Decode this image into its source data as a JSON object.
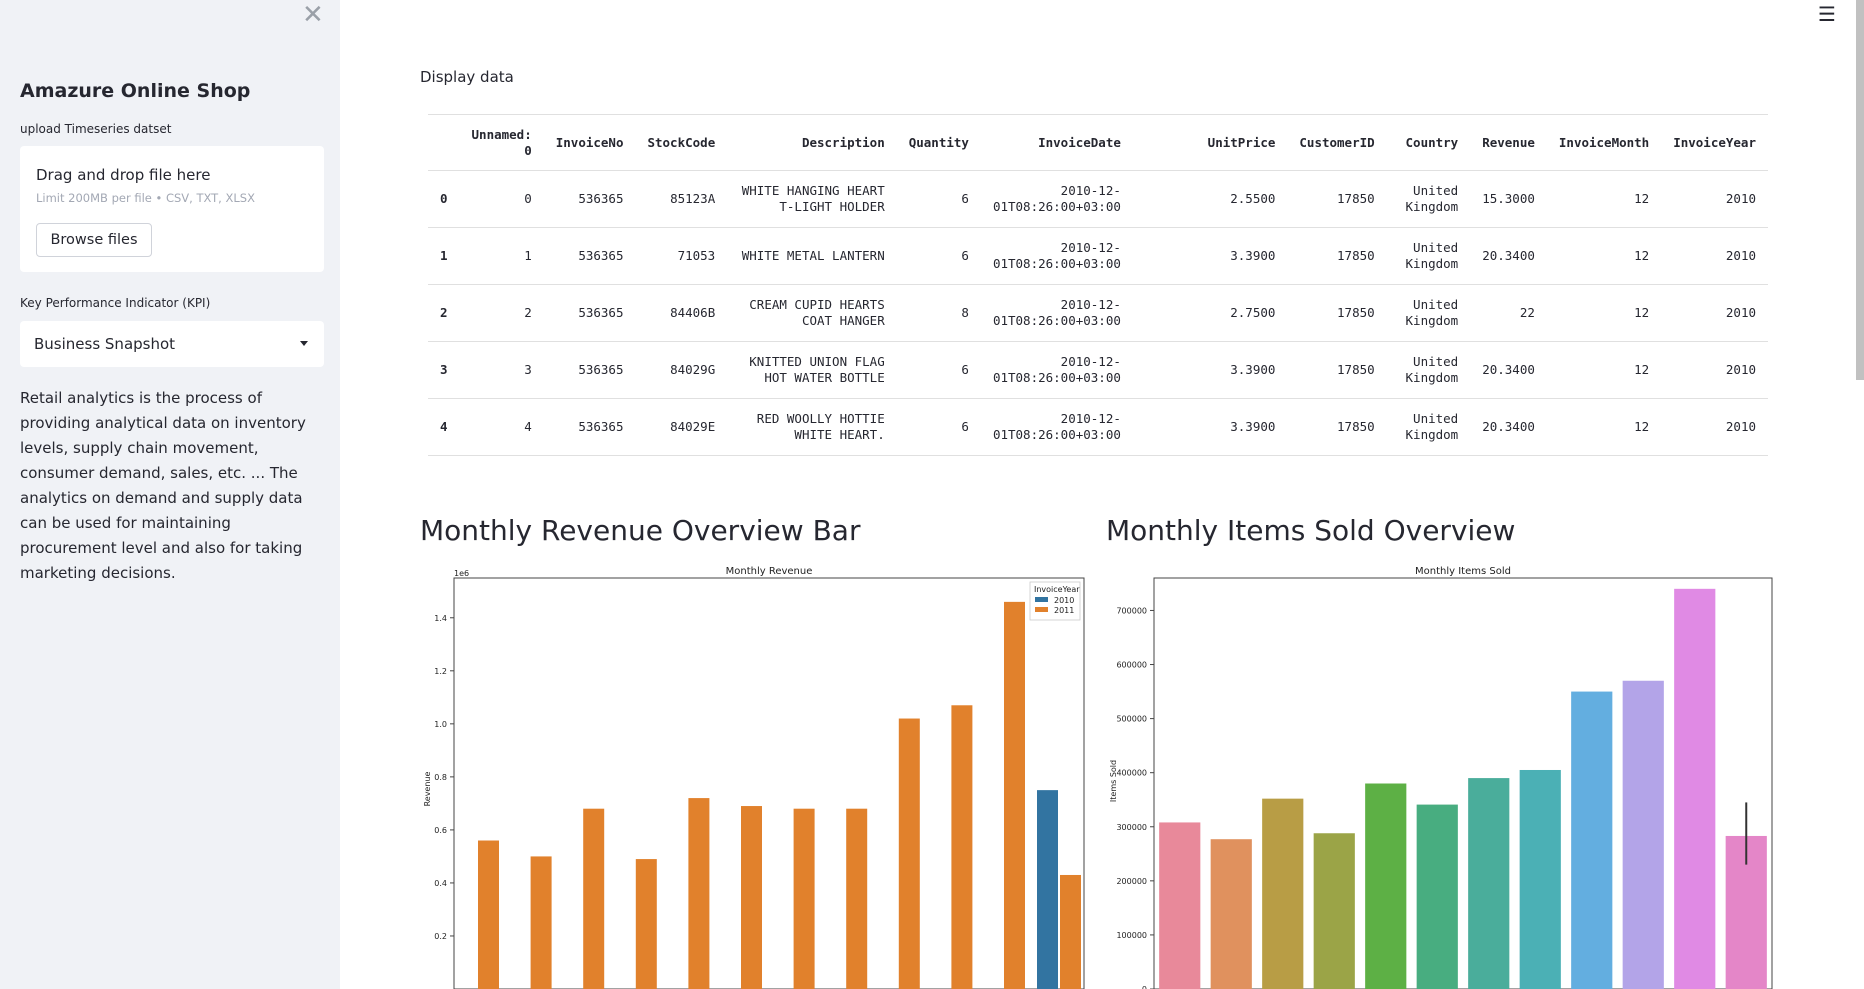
{
  "sidebar": {
    "title": "Amazure Online Shop",
    "upload_label": "upload Timeseries datset",
    "uploader_title": "Drag and drop file here",
    "uploader_limit": "Limit 200MB per file • CSV, TXT, XLSX",
    "browse_label": "Browse files",
    "kpi_label": "Key Performance Indicator (KPI)",
    "kpi_selected": "Business Snapshot",
    "description": "Retail analytics is the process of providing analytical data on inventory levels, supply chain movement, consumer demand, sales, etc. ... The analytics on demand and supply data can be used for maintaining procurement level and also for taking marketing decisions."
  },
  "main": {
    "display_label": "Display data",
    "table": {
      "headers": [
        "Unnamed: 0",
        "InvoiceNo",
        "StockCode",
        "Description",
        "Quantity",
        "InvoiceDate",
        "UnitPrice",
        "CustomerID",
        "Country",
        "Revenue",
        "InvoiceMonth",
        "InvoiceYear"
      ],
      "rows": [
        [
          "0",
          "0",
          "536365",
          "85123A",
          "WHITE HANGING HEART T-LIGHT HOLDER",
          "6",
          "2010-12-01T08:26:00+03:00",
          "2.5500",
          "17850",
          "United Kingdom",
          "15.3000",
          "12",
          "2010"
        ],
        [
          "1",
          "1",
          "536365",
          "71053",
          "WHITE METAL LANTERN",
          "6",
          "2010-12-01T08:26:00+03:00",
          "3.3900",
          "17850",
          "United Kingdom",
          "20.3400",
          "12",
          "2010"
        ],
        [
          "2",
          "2",
          "536365",
          "84406B",
          "CREAM CUPID HEARTS COAT HANGER",
          "8",
          "2010-12-01T08:26:00+03:00",
          "2.7500",
          "17850",
          "United Kingdom",
          "22",
          "12",
          "2010"
        ],
        [
          "3",
          "3",
          "536365",
          "84029G",
          "KNITTED UNION FLAG HOT WATER BOTTLE",
          "6",
          "2010-12-01T08:26:00+03:00",
          "3.3900",
          "17850",
          "United Kingdom",
          "20.3400",
          "12",
          "2010"
        ],
        [
          "4",
          "4",
          "536365",
          "84029E",
          "RED WOOLLY HOTTIE WHITE HEART.",
          "6",
          "2010-12-01T08:26:00+03:00",
          "3.3900",
          "17850",
          "United Kingdom",
          "20.3400",
          "12",
          "2010"
        ]
      ]
    },
    "revenue_section_title": "Monthly Revenue Overview Bar",
    "items_section_title": "Monthly Items Sold Overview"
  },
  "chart_data": [
    {
      "type": "bar",
      "title": "Monthly Revenue",
      "xlabel": "",
      "ylabel": "Revenue",
      "scale_label": "1e6",
      "ylim": [
        0,
        1.55
      ],
      "yticks": [
        "0.2",
        "0.4",
        "0.6",
        "0.8",
        "1.0",
        "1.2",
        "1.4"
      ],
      "legend_title": "InvoiceYear",
      "legend_position": "top-right",
      "series": [
        {
          "name": "2010",
          "color": "#3274a1",
          "values": [
            0.75
          ]
        },
        {
          "name": "2011",
          "color": "#e1812c",
          "values": [
            0.56,
            0.5,
            0.68,
            0.49,
            0.72,
            0.69,
            0.68,
            0.68,
            1.02,
            1.07,
            1.46,
            0.43
          ]
        }
      ]
    },
    {
      "type": "bar",
      "title": "Monthly Items Sold",
      "xlabel": "",
      "ylabel": "Items Sold",
      "ylim": [
        0,
        760000
      ],
      "yticks": [
        "0",
        "100000",
        "200000",
        "300000",
        "400000",
        "500000",
        "600000",
        "700000"
      ],
      "values": [
        308000,
        277000,
        352000,
        288000,
        380000,
        341000,
        390000,
        405000,
        550000,
        570000,
        740000,
        283000
      ],
      "colors": [
        "#e8899a",
        "#e0915e",
        "#b89d45",
        "#9ba447",
        "#5db045",
        "#48ad80",
        "#4aad9b",
        "#4bb0b5",
        "#63aee0",
        "#b3a4e8",
        "#e08ae4",
        "#e486c8"
      ],
      "error_bar_index": 11,
      "error_bar_range": [
        230000,
        345000
      ]
    }
  ]
}
